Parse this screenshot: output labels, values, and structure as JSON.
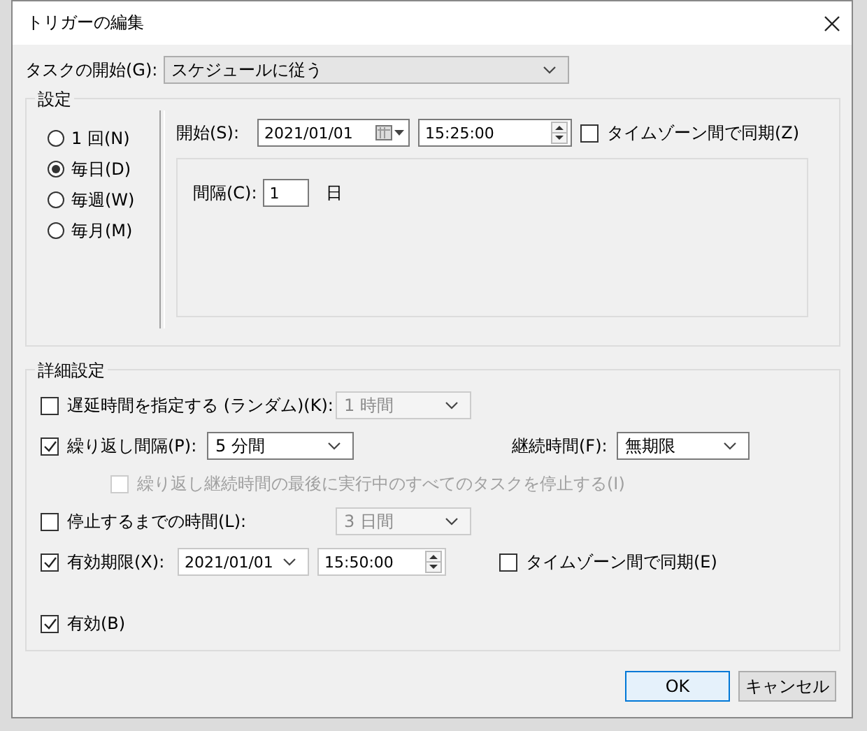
{
  "window": {
    "title": "トリガーの編集"
  },
  "start_task": {
    "label": "タスクの開始(G):",
    "value": "スケジュールに従う"
  },
  "settings": {
    "title": "設定",
    "schedule_options": [
      {
        "label": "1 回(N)",
        "selected": false
      },
      {
        "label": "毎日(D)",
        "selected": true
      },
      {
        "label": "毎週(W)",
        "selected": false
      },
      {
        "label": "毎月(M)",
        "selected": false
      }
    ],
    "start": {
      "label": "開始(S):",
      "date": "2021/01/01",
      "time": "15:25:00"
    },
    "sync_timezone": {
      "label": "タイムゾーン間で同期(Z)",
      "checked": false
    },
    "interval": {
      "label": "間隔(C):",
      "value": "1",
      "unit": "日"
    }
  },
  "advanced": {
    "title": "詳細設定",
    "delay": {
      "label": "遅延時間を指定する (ランダム)(K):",
      "checked": false,
      "value": "1 時間",
      "disabled": true
    },
    "repeat": {
      "label": "繰り返し間隔(P):",
      "checked": true,
      "value": "5 分間",
      "disabled": false
    },
    "duration": {
      "label": "継続時間(F):",
      "value": "無期限",
      "disabled": false
    },
    "stop_at_end": {
      "label": "繰り返し継続時間の最後に実行中のすべてのタスクを停止する(I)",
      "checked": false,
      "disabled": true
    },
    "stop_after": {
      "label": "停止するまでの時間(L):",
      "checked": false,
      "value": "3 日間",
      "disabled": true
    },
    "expire": {
      "label": "有効期限(X):",
      "checked": true,
      "date": "2021/01/01",
      "time": "15:50:00"
    },
    "expire_sync": {
      "label": "タイムゾーン間で同期(E)",
      "checked": false
    },
    "enabled": {
      "label": "有効(B)",
      "checked": true
    }
  },
  "buttons": [
    {
      "label": "OK",
      "kind": "default"
    },
    {
      "label": "キャンセル",
      "kind": "normal"
    }
  ]
}
